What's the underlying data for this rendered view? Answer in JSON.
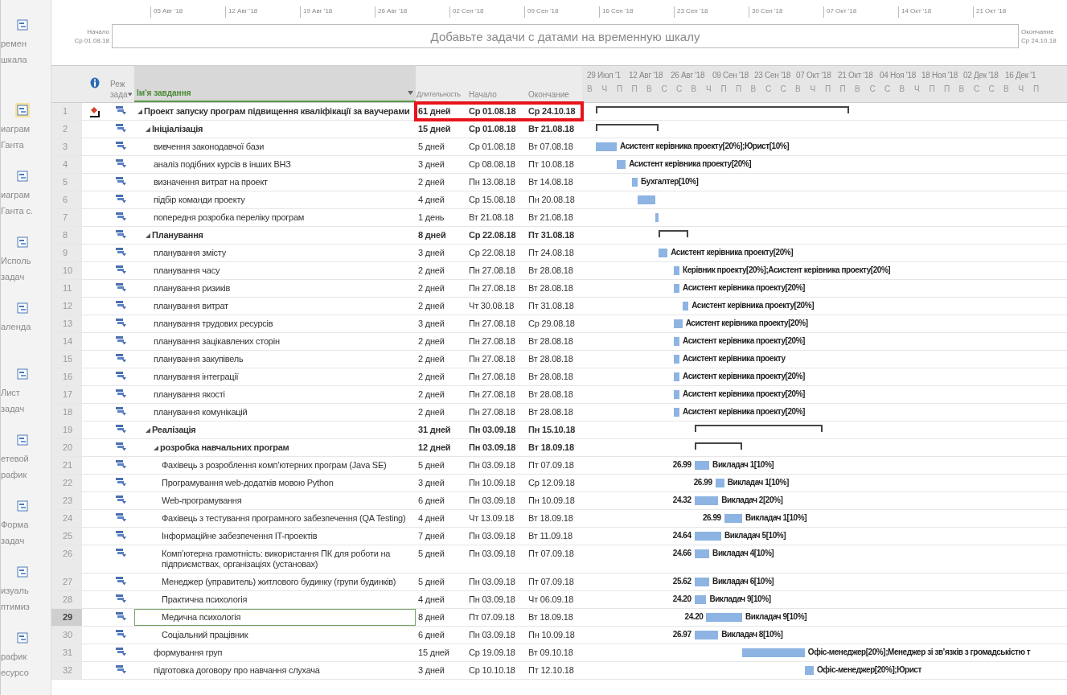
{
  "sidebar": {
    "items": [
      {
        "lines": [
          "ремен",
          "шкала"
        ],
        "selected": false
      },
      {
        "lines": [
          "иаграм",
          "Ганта"
        ],
        "selected": true
      },
      {
        "lines": [
          "иаграм",
          "Ганта с."
        ],
        "selected": false
      },
      {
        "lines": [
          "Исполь",
          "задач"
        ],
        "selected": false
      },
      {
        "lines": [
          "аленда"
        ],
        "selected": false
      },
      {
        "lines": [
          "Лист",
          "задач"
        ],
        "selected": false
      },
      {
        "lines": [
          "етевой",
          "рафик"
        ],
        "selected": false
      },
      {
        "lines": [
          "Форма",
          "задач"
        ],
        "selected": false
      },
      {
        "lines": [
          "изуаль",
          "птимиз"
        ],
        "selected": false
      },
      {
        "lines": [
          "рафик",
          "есурсо"
        ],
        "selected": false
      }
    ]
  },
  "timeline": {
    "dates": [
      "05 Авг '18",
      "12 Авг '18",
      "19 Авг '18",
      "26 Авг '18",
      "02 Сен '18",
      "09 Сен '18",
      "16 Сен '18",
      "23 Сен '18",
      "30 Сен '18",
      "07 Окт '18",
      "14 Окт '18",
      "21 Окт '18"
    ],
    "start_label": "Начало",
    "start_date": "Ср 01.08.18",
    "hint": "Добавьте задачи с датами на временную шкалу",
    "end_label": "Окончание",
    "end_date": "Ср 24.10.18"
  },
  "table": {
    "columns": {
      "mode": [
        "Реж",
        "зада"
      ],
      "name": "Ім'я завдання",
      "duration": "Длительность",
      "start": "Начало",
      "finish": "Окончание"
    }
  },
  "gantt": {
    "dates": [
      "29 Июл '1",
      "12 Авг '18",
      "26 Авг '18",
      "09 Сен '18",
      "23 Сен '18",
      "07 Окт '18",
      "21 Окт '18",
      "04 Ноя '18",
      "18 Ноя '18",
      "02 Дек '18",
      "16 Дек '1"
    ],
    "days": [
      "В",
      "Ч",
      "П",
      "П",
      "В",
      "С",
      "С",
      "В",
      "Ч",
      "П",
      "П",
      "В",
      "С",
      "С",
      "В",
      "Ч",
      "П",
      "П",
      "В",
      "С",
      "С",
      "В",
      "Ч",
      "П",
      "П",
      "В",
      "С",
      "С",
      "В",
      "Ч",
      "П"
    ]
  },
  "tasks": [
    {
      "num": "1",
      "name": "Проект запуску програм підвищення кваліфікації за ваучерами",
      "duration": "61 дней",
      "start": "Ср 01.08.18",
      "finish": "Ср 24.10.18",
      "kind": "summary",
      "expanded": true,
      "indicator": true,
      "highlighted": true,
      "selected": false,
      "children": [
        {
          "num": "2",
          "name": "Ініціалізація",
          "duration": "15 дней",
          "start": "Ср 01.08.18",
          "finish": "Вт 21.08.18",
          "kind": "summary",
          "expanded": true,
          "indicator": false,
          "highlighted": false,
          "selected": false,
          "children": [
            {
              "num": "3",
              "name": "вивчення законодавчої бази",
              "duration": "5 дней",
              "start": "Ср 01.08.18",
              "finish": "Вт 07.08.18",
              "kind": "task",
              "indicator": false,
              "highlighted": false,
              "selected": false,
              "resources": "Асистент керівника проекту[20%];Юрист[10%]"
            },
            {
              "num": "4",
              "name": "аналіз подібних курсів в інших ВНЗ",
              "duration": "3 дней",
              "start": "Ср 08.08.18",
              "finish": "Пт 10.08.18",
              "kind": "task",
              "indicator": false,
              "highlighted": false,
              "selected": false,
              "resources": "Асистент керівника проекту[20%]"
            },
            {
              "num": "5",
              "name": "визначення витрат на проект",
              "duration": "2 дней",
              "start": "Пн 13.08.18",
              "finish": "Вт 14.08.18",
              "kind": "task",
              "indicator": false,
              "highlighted": false,
              "selected": false,
              "resources": "Бухгалтер[10%]"
            },
            {
              "num": "6",
              "name": "підбір команди проекту",
              "duration": "4 дней",
              "start": "Ср 15.08.18",
              "finish": "Пн 20.08.18",
              "kind": "task",
              "indicator": false,
              "highlighted": false,
              "selected": false
            },
            {
              "num": "7",
              "name": "попередня розробка переліку програм",
              "duration": "1 день",
              "start": "Вт 21.08.18",
              "finish": "Вт 21.08.18",
              "kind": "task",
              "indicator": false,
              "highlighted": false,
              "selected": false
            }
          ]
        },
        {
          "num": "8",
          "name": "Планування",
          "duration": "8 дней",
          "start": "Ср 22.08.18",
          "finish": "Пт 31.08.18",
          "kind": "summary",
          "expanded": true,
          "indicator": false,
          "highlighted": false,
          "selected": false,
          "children": [
            {
              "num": "9",
              "name": "планування змісту",
              "duration": "3 дней",
              "start": "Ср 22.08.18",
              "finish": "Пт 24.08.18",
              "kind": "task",
              "indicator": false,
              "highlighted": false,
              "selected": false,
              "resources": "Асистент керівника проекту[20%]"
            },
            {
              "num": "10",
              "name": "планування часу",
              "duration": "2 дней",
              "start": "Пн 27.08.18",
              "finish": "Вт 28.08.18",
              "kind": "task",
              "indicator": false,
              "highlighted": false,
              "selected": false,
              "resources": "Керівник проекту[20%];Асистент керівника проекту[20%]"
            },
            {
              "num": "11",
              "name": "планування ризиків",
              "duration": "2 дней",
              "start": "Пн 27.08.18",
              "finish": "Вт 28.08.18",
              "kind": "task",
              "indicator": false,
              "highlighted": false,
              "selected": false,
              "resources": "Асистент керівника проекту[20%]"
            },
            {
              "num": "12",
              "name": "планування витрат",
              "duration": "2 дней",
              "start": "Чт 30.08.18",
              "finish": "Пт 31.08.18",
              "kind": "task",
              "indicator": false,
              "highlighted": false,
              "selected": false,
              "resources": "Асистент керівника проекту[20%]"
            },
            {
              "num": "13",
              "name": "планування трудових ресурсів",
              "duration": "3 дней",
              "start": "Пн 27.08.18",
              "finish": "Ср 29.08.18",
              "kind": "task",
              "indicator": false,
              "highlighted": false,
              "selected": false,
              "resources": "Асистент керівника проекту[20%]"
            },
            {
              "num": "14",
              "name": "планування зацікавлених сторін",
              "duration": "2 дней",
              "start": "Пн 27.08.18",
              "finish": "Вт 28.08.18",
              "kind": "task",
              "indicator": false,
              "highlighted": false,
              "selected": false,
              "resources": "Асистент керівника проекту[20%]"
            },
            {
              "num": "15",
              "name": "планування закупівель",
              "duration": "2 дней",
              "start": "Пн 27.08.18",
              "finish": "Вт 28.08.18",
              "kind": "task",
              "indicator": false,
              "highlighted": false,
              "selected": false,
              "resources": "Асистент керівника проекту"
            },
            {
              "num": "16",
              "name": "планування інтеграції",
              "duration": "2 дней",
              "start": "Пн 27.08.18",
              "finish": "Вт 28.08.18",
              "kind": "task",
              "indicator": false,
              "highlighted": false,
              "selected": false,
              "resources": "Асистент керівника проекту[20%]"
            },
            {
              "num": "17",
              "name": "планування якості",
              "duration": "2 дней",
              "start": "Пн 27.08.18",
              "finish": "Вт 28.08.18",
              "kind": "task",
              "indicator": false,
              "highlighted": false,
              "selected": false,
              "resources": "Асистент керівника проекту[20%]"
            },
            {
              "num": "18",
              "name": "планування комунікацій",
              "duration": "2 дней",
              "start": "Пн 27.08.18",
              "finish": "Вт 28.08.18",
              "kind": "task",
              "indicator": false,
              "highlighted": false,
              "selected": false,
              "resources": "Асистент керівника проекту[20%]"
            }
          ]
        },
        {
          "num": "19",
          "name": "Реалізація",
          "duration": "31 дней",
          "start": "Пн 03.09.18",
          "finish": "Пн 15.10.18",
          "kind": "summary",
          "expanded": true,
          "indicator": false,
          "highlighted": false,
          "selected": false,
          "children": [
            {
              "num": "20",
              "name": "розробка навчальних програм",
              "duration": "12 дней",
              "start": "Пн 03.09.18",
              "finish": "Вт 18.09.18",
              "kind": "summary",
              "expanded": true,
              "indicator": false,
              "highlighted": false,
              "selected": false,
              "children": [
                {
                  "num": "21",
                  "name": "Фахівець з розроблення комп’ютерних програм (Java SE)",
                  "duration": "5 дней",
                  "start": "Пн 03.09.18",
                  "finish": "Пт 07.09.18",
                  "kind": "task",
                  "indicator": false,
                  "highlighted": false,
                  "selected": false,
                  "cost": "26.99",
                  "resources": "Викладач 1[10%]"
                },
                {
                  "num": "22",
                  "name": "Програмування web-додатків мовою Python",
                  "duration": "3 дней",
                  "start": "Пн 10.09.18",
                  "finish": "Ср 12.09.18",
                  "kind": "task",
                  "indicator": false,
                  "highlighted": false,
                  "selected": false,
                  "cost": "26.99",
                  "resources": "Викладач 1[10%]"
                },
                {
                  "num": "23",
                  "name": "Web-програмування",
                  "duration": "6 дней",
                  "start": "Пн 03.09.18",
                  "finish": "Пн 10.09.18",
                  "kind": "task",
                  "indicator": false,
                  "highlighted": false,
                  "selected": false,
                  "cost": "24.32",
                  "resources": "Викладач 2[20%]"
                },
                {
                  "num": "24",
                  "name": "Фахівець з тестування програмного забезпечення (QA Testing)",
                  "duration": "4 дней",
                  "start": "Чт 13.09.18",
                  "finish": "Вт 18.09.18",
                  "kind": "task",
                  "indicator": false,
                  "highlighted": false,
                  "selected": false,
                  "cost": "26.99",
                  "resources": "Викладач 1[10%]"
                },
                {
                  "num": "25",
                  "name": "Інформаційне забезпечення IT-проектів",
                  "duration": "7 дней",
                  "start": "Пн 03.09.18",
                  "finish": "Вт 11.09.18",
                  "kind": "task",
                  "indicator": false,
                  "highlighted": false,
                  "selected": false,
                  "cost": "24.64",
                  "resources": "Викладач 5[10%]"
                },
                {
                  "num": "26",
                  "name": "Комп’ютерна грамотність: використання ПК для роботи на підприємствах, організаціях (установах)",
                  "duration": "5 дней",
                  "start": "Пн 03.09.18",
                  "finish": "Пт 07.09.18",
                  "kind": "task",
                  "indicator": false,
                  "highlighted": false,
                  "selected": false,
                  "cost": "24.66",
                  "resources": "Викладач 4[10%]"
                },
                {
                  "num": "27",
                  "name": "Менеджер (управитель) житлового будинку (групи будинків)",
                  "duration": "5 дней",
                  "start": "Пн 03.09.18",
                  "finish": "Пт 07.09.18",
                  "kind": "task",
                  "indicator": false,
                  "highlighted": false,
                  "selected": false,
                  "cost": "25.62",
                  "resources": "Викладач 6[10%]"
                },
                {
                  "num": "28",
                  "name": "Практична психологія",
                  "duration": "4 дней",
                  "start": "Пн 03.09.18",
                  "finish": "Чт 06.09.18",
                  "kind": "task",
                  "indicator": false,
                  "highlighted": false,
                  "selected": false,
                  "cost": "24.20",
                  "resources": "Викладач 9[10%]"
                },
                {
                  "num": "29",
                  "name": "Медична психологія",
                  "duration": "8 дней",
                  "start": "Пт 07.09.18",
                  "finish": "Вт 18.09.18",
                  "kind": "task",
                  "indicator": false,
                  "highlighted": false,
                  "selected": true,
                  "cost": "24.20",
                  "resources": "Викладач 9[10%]"
                },
                {
                  "num": "30",
                  "name": "Соціальний працівник",
                  "duration": "6 дней",
                  "start": "Пн 03.09.18",
                  "finish": "Пн 10.09.18",
                  "kind": "task",
                  "indicator": false,
                  "highlighted": false,
                  "selected": false,
                  "cost": "26.97",
                  "resources": "Викладач 8[10%]"
                }
              ]
            },
            {
              "num": "31",
              "name": "формування груп",
              "duration": "15 дней",
              "start": "Ср 19.09.18",
              "finish": "Вт 09.10.18",
              "kind": "task",
              "indicator": false,
              "highlighted": false,
              "selected": false,
              "resources": "Офіс-менеджер[20%];Менеджер зі зв’язків з громадськістю т"
            },
            {
              "num": "32",
              "name": "підготовка договору про навчання слухача",
              "duration": "3 дней",
              "start": "Ср 10.10.18",
              "finish": "Пт 12.10.18",
              "kind": "task",
              "indicator": false,
              "highlighted": false,
              "selected": false,
              "resources": "Офіс-менеджер[20%];Юрист"
            }
          ]
        }
      ]
    }
  ]
}
